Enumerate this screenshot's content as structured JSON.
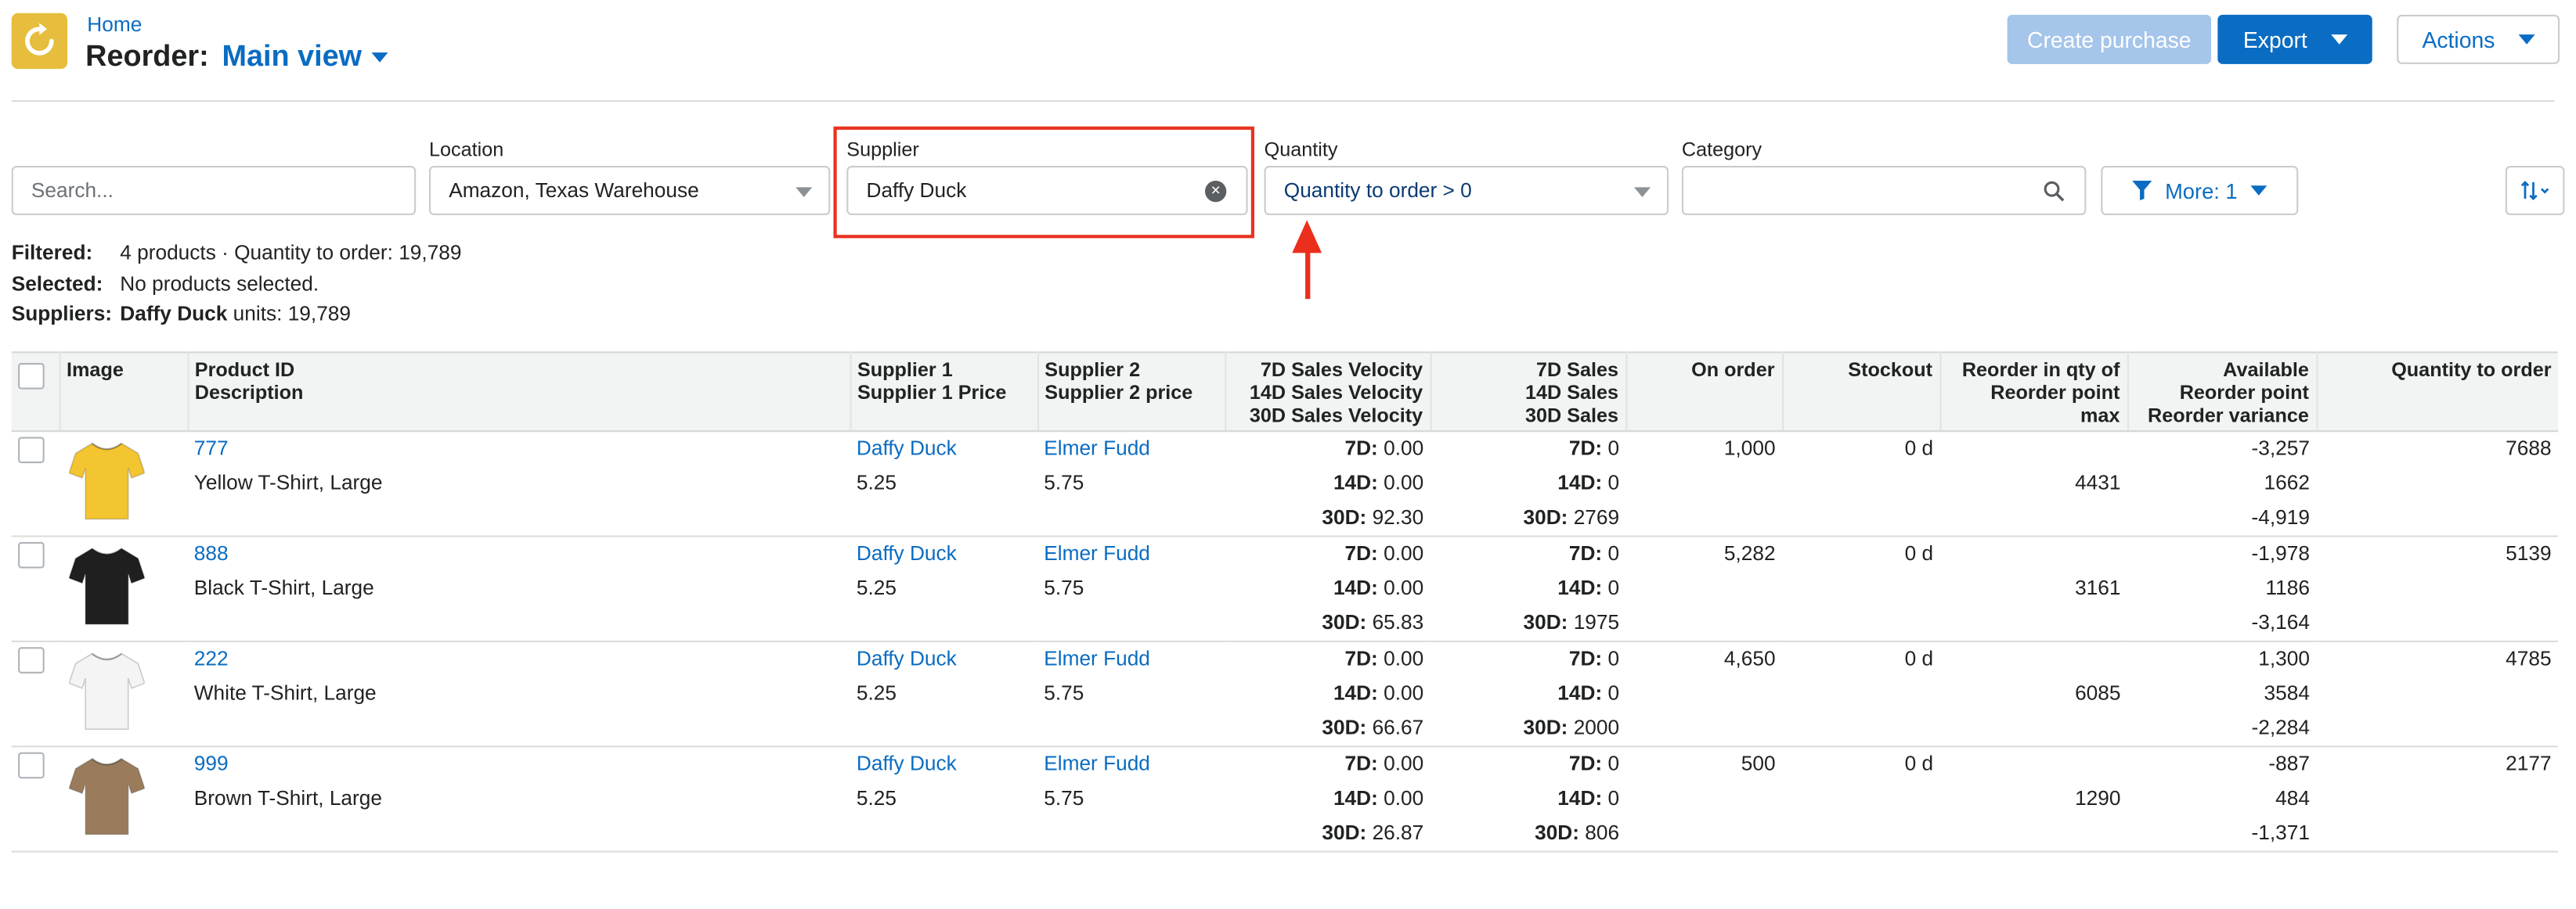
{
  "header": {
    "breadcrumb": "Home",
    "title_prefix": "Reorder:",
    "view_name": "Main view",
    "create_purchase_label": "Create purchase",
    "export_label": "Export",
    "actions_label": "Actions",
    "logo_icon": "refresh-icon",
    "logo_color": "#e6bd3c"
  },
  "filters": {
    "search_placeholder": "Search...",
    "location_label": "Location",
    "location_value": "Amazon, Texas Warehouse",
    "supplier_label": "Supplier",
    "supplier_value": "Daffy Duck",
    "quantity_label": "Quantity",
    "quantity_value": "Quantity to order > 0",
    "category_label": "Category",
    "category_value": "",
    "more_label": "More: 1"
  },
  "summary": {
    "filtered_key": "Filtered:",
    "filtered_value": "4 products · Quantity to order: 19,789",
    "selected_key": "Selected:",
    "selected_value": "No products selected.",
    "suppliers_key": "Suppliers:",
    "suppliers_name": "Daffy Duck",
    "suppliers_units": "units: 19,789"
  },
  "table": {
    "headers": {
      "image": "Image",
      "product_id": "Product ID",
      "description": "Description",
      "supplier1": "Supplier 1",
      "supplier1_price": "Supplier 1 Price",
      "supplier2": "Supplier 2",
      "supplier2_price": "Supplier 2 price",
      "vel7": "7D Sales Velocity",
      "vel14": "14D Sales Velocity",
      "vel30": "30D Sales Velocity",
      "sales7": "7D Sales",
      "sales14": "14D Sales",
      "sales30": "30D Sales",
      "on_order": "On order",
      "stockout": "Stockout",
      "reorder_qty": "Reorder in qty of",
      "reorder_max": "Reorder point max",
      "available": "Available",
      "reorder_point": "Reorder point",
      "reorder_variance": "Reorder variance",
      "qty_to_order": "Quantity to order"
    },
    "labels": {
      "d7": "7D:",
      "d14": "14D:",
      "d30": "30D:"
    },
    "rows": [
      {
        "id": "777",
        "description": "Yellow T-Shirt, Large",
        "shirt_color": "#f2c531",
        "supplier1": "Daffy Duck",
        "supplier1_price": "5.25",
        "supplier2": "Elmer Fudd",
        "supplier2_price": "5.75",
        "vel7": "0.00",
        "vel14": "0.00",
        "vel30": "92.30",
        "sales7": "0",
        "sales14": "0",
        "sales30": "2769",
        "on_order": "1,000",
        "stockout": "0 d",
        "reorder_qty": "",
        "reorder_max": "4431",
        "available": "-3,257",
        "reorder_point": "1662",
        "reorder_variance": "-4,919",
        "qty_to_order": "7688"
      },
      {
        "id": "888",
        "description": "Black T-Shirt, Large",
        "shirt_color": "#1f1f1f",
        "supplier1": "Daffy Duck",
        "supplier1_price": "5.25",
        "supplier2": "Elmer Fudd",
        "supplier2_price": "5.75",
        "vel7": "0.00",
        "vel14": "0.00",
        "vel30": "65.83",
        "sales7": "0",
        "sales14": "0",
        "sales30": "1975",
        "on_order": "5,282",
        "stockout": "0 d",
        "reorder_qty": "",
        "reorder_max": "3161",
        "available": "-1,978",
        "reorder_point": "1186",
        "reorder_variance": "-3,164",
        "qty_to_order": "5139"
      },
      {
        "id": "222",
        "description": "White T-Shirt, Large",
        "shirt_color": "#f4f4f4",
        "supplier1": "Daffy Duck",
        "supplier1_price": "5.25",
        "supplier2": "Elmer Fudd",
        "supplier2_price": "5.75",
        "vel7": "0.00",
        "vel14": "0.00",
        "vel30": "66.67",
        "sales7": "0",
        "sales14": "0",
        "sales30": "2000",
        "on_order": "4,650",
        "stockout": "0 d",
        "reorder_qty": "",
        "reorder_max": "6085",
        "available": "1,300",
        "reorder_point": "3584",
        "reorder_variance": "-2,284",
        "qty_to_order": "4785"
      },
      {
        "id": "999",
        "description": "Brown T-Shirt, Large",
        "shirt_color": "#9a7c5c",
        "supplier1": "Daffy Duck",
        "supplier1_price": "5.25",
        "supplier2": "Elmer Fudd",
        "supplier2_price": "5.75",
        "vel7": "0.00",
        "vel14": "0.00",
        "vel30": "26.87",
        "sales7": "0",
        "sales14": "0",
        "sales30": "806",
        "on_order": "500",
        "stockout": "0 d",
        "reorder_qty": "",
        "reorder_max": "1290",
        "available": "-887",
        "reorder_point": "484",
        "reorder_variance": "-1,371",
        "qty_to_order": "2177"
      }
    ]
  },
  "colors": {
    "accent": "#0a6cc2",
    "highlight": "#e8321f"
  }
}
